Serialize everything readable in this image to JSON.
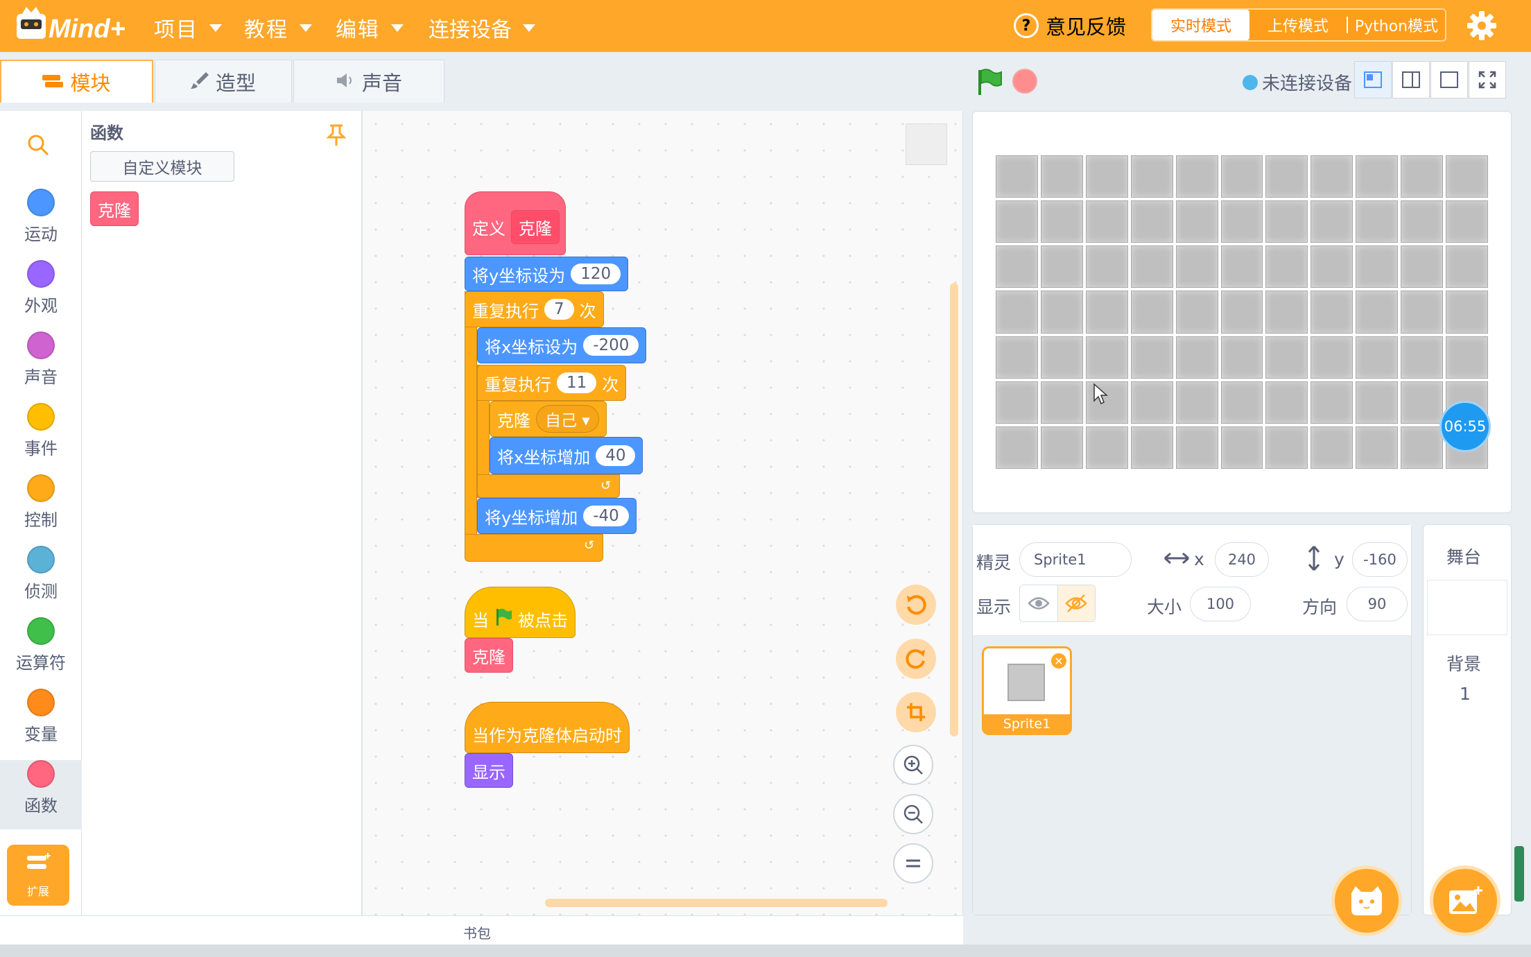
{
  "app": {
    "logo_text": "Mind+"
  },
  "menu": {
    "project": "项目",
    "tutorial": "教程",
    "edit": "编辑",
    "connect": "连接设备"
  },
  "header": {
    "feedback": "意见反馈",
    "modes": {
      "realtime": "实时模式",
      "upload": "上传模式",
      "python": "Python模式"
    }
  },
  "tabs": {
    "blocks": "模块",
    "costumes": "造型",
    "sounds": "声音"
  },
  "stage_controls": {
    "connection_status": "未连接设备"
  },
  "categories": [
    {
      "label": "运动",
      "color": "#4c97ff"
    },
    {
      "label": "外观",
      "color": "#9966ff"
    },
    {
      "label": "声音",
      "color": "#cf63cf"
    },
    {
      "label": "事件",
      "color": "#ffbf00"
    },
    {
      "label": "控制",
      "color": "#ffab19"
    },
    {
      "label": "侦测",
      "color": "#5cb1d6"
    },
    {
      "label": "运算符",
      "color": "#40bf4a"
    },
    {
      "label": "变量",
      "color": "#ff8c1a"
    },
    {
      "label": "函数",
      "color": "#ff6680"
    }
  ],
  "extension": {
    "label": "扩展"
  },
  "palette": {
    "title": "函数",
    "custom_block_button": "自定义模块",
    "clone_block": "克隆"
  },
  "script": {
    "define_label": "定义",
    "define_name": "克隆",
    "set_y_label": "将y坐标设为",
    "set_y_value": "120",
    "repeat1_label": "重复执行",
    "repeat1_value": "7",
    "times_label": "次",
    "set_x_label": "将x坐标设为",
    "set_x_value": "-200",
    "repeat2_label": "重复执行",
    "repeat2_value": "11",
    "times2_label": "次",
    "clone_label": "克隆",
    "clone_target": "自己",
    "change_x_label": "将x坐标增加",
    "change_x_value": "40",
    "change_y_label": "将y坐标增加",
    "change_y_value": "-40",
    "when_label": "当",
    "clicked_label": "被点击",
    "call_clone": "克隆",
    "when_clone": "当作为克隆体启动时",
    "show": "显示"
  },
  "backpack": {
    "label": "书包"
  },
  "stage": {
    "timer": "06:55",
    "rows": 7,
    "cols": 11
  },
  "sprite_info": {
    "sprite_label": "精灵",
    "sprite_name": "Sprite1",
    "x_label": "x",
    "x_value": "240",
    "y_label": "y",
    "y_value": "-160",
    "show_label": "显示",
    "size_label": "大小",
    "size_value": "100",
    "direction_label": "方向",
    "direction_value": "90"
  },
  "sprite_list": [
    {
      "name": "Sprite1"
    }
  ],
  "stage_panel": {
    "title": "舞台",
    "backdrop_label": "背景",
    "backdrop_count": "1"
  }
}
